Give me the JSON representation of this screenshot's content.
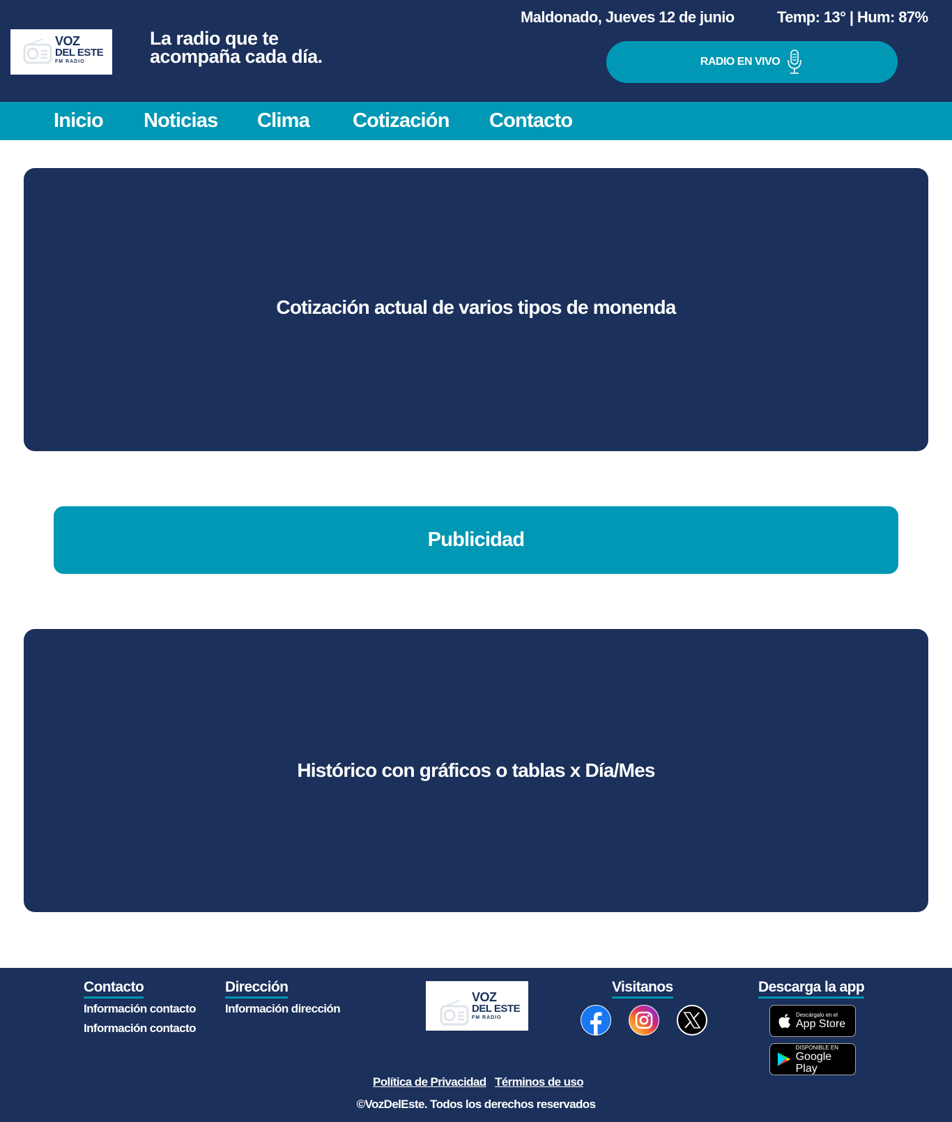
{
  "header": {
    "logo": {
      "line1": "VOZ",
      "line2": "DEL ESTE",
      "line3": "FM RADIO"
    },
    "tagline": "La radio que te acompaña cada día.",
    "date": "Maldonado, Jueves 12 de junio",
    "weather": "Temp: 13° | Hum: 87%",
    "live_button": "RADIO EN VIVO",
    "live_icon": "microphone-icon"
  },
  "nav": {
    "items": [
      "Inicio",
      "Noticias",
      "Clima",
      "Cotización",
      "Contacto"
    ]
  },
  "main": {
    "current_rates": "Cotización actual de varios tipos de monenda",
    "advertising": "Publicidad",
    "history": "Histórico con gráficos o tablas x Día/Mes"
  },
  "footer": {
    "contact": {
      "title": "Contacto",
      "items": [
        "Información contacto",
        "Información contacto"
      ]
    },
    "address": {
      "title": "Dirección",
      "items": [
        "Información dirección"
      ]
    },
    "logo": {
      "line1": "VOZ",
      "line2": "DEL ESTE",
      "line3": "FM RADIO"
    },
    "visit": {
      "title": "Visitanos",
      "icons": [
        "facebook-icon",
        "instagram-icon",
        "x-icon"
      ]
    },
    "app": {
      "title": "Descarga la app",
      "app_store": {
        "small": "Descárgalo en el",
        "large": "App Store"
      },
      "google_play": {
        "small": "DISPONIBLE EN",
        "large": "Google Play"
      }
    },
    "privacy": "Política de Privacidad",
    "terms": "Términos de uso",
    "copyright": "©VozDelEste. Todos los derechos reservados"
  },
  "colors": {
    "navy": "#1b305b",
    "teal": "#0098b4",
    "white": "#ffffff"
  }
}
